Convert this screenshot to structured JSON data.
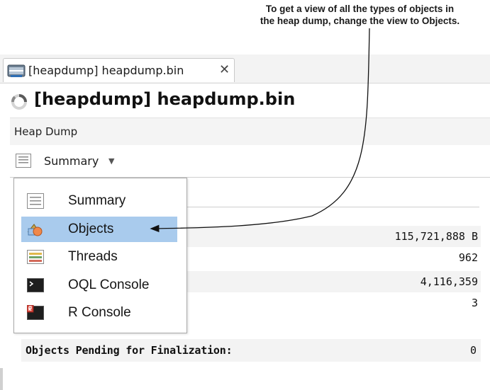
{
  "annotation": {
    "line1": "To get a view of all the types of objects in",
    "line2": "the heap dump, change the view to Objects."
  },
  "tab": {
    "label": "[heapdump] heapdump.bin",
    "close_glyph": "✕"
  },
  "document": {
    "title": "[heapdump] heapdump.bin",
    "icon": "spinner-icon"
  },
  "heap_bar": {
    "label": "Heap Dump"
  },
  "view_selector": {
    "label": "Summary",
    "caret": "▼",
    "icon": "summary-icon"
  },
  "menu": {
    "items": [
      {
        "label": "Summary",
        "icon": "summary-icon",
        "selected": false
      },
      {
        "label": "Objects",
        "icon": "objects-icon",
        "selected": true
      },
      {
        "label": "Threads",
        "icon": "threads-icon",
        "selected": false
      },
      {
        "label": "OQL Console",
        "icon": "oql-console-icon",
        "selected": false
      },
      {
        "label": "R Console",
        "icon": "r-console-icon",
        "selected": false
      }
    ]
  },
  "stats": {
    "values": [
      "115,721,888 B",
      "962",
      "4,116,359",
      "3"
    ]
  },
  "finalization": {
    "label": "Objects Pending for Finalization:",
    "value": "0"
  },
  "colors": {
    "selection": "#a9cbed",
    "tabstrip": "#f3f3f3",
    "row_shade": "#f3f3f3"
  }
}
